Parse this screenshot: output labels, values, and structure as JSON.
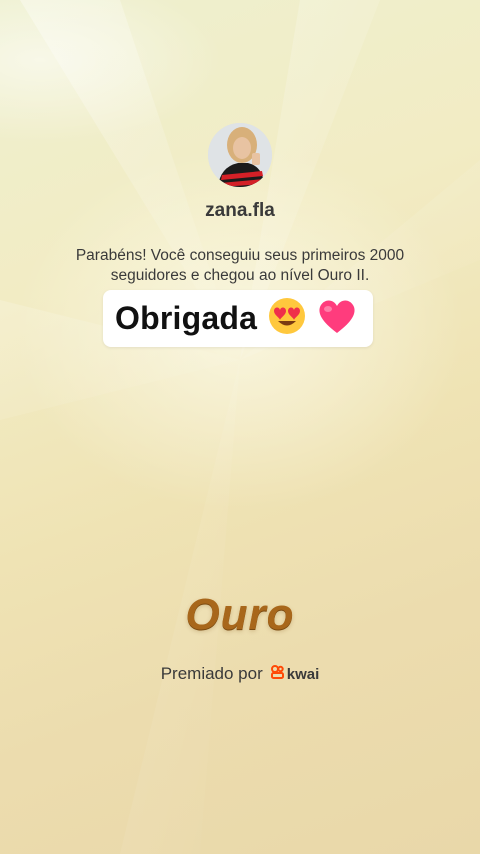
{
  "profile": {
    "username": "zana.fla"
  },
  "message": {
    "text": "Parabéns! Você conseguiu seus primeiros 2000 seguidores e chegou ao nível Ouro II."
  },
  "sticker": {
    "text": "Obrigada",
    "emojis": [
      "smiling-face-with-heart-eyes-icon",
      "pink-heart-icon"
    ]
  },
  "level": {
    "name": "Ouro"
  },
  "award": {
    "prefix": "Premiado por",
    "brand": "kwai",
    "brand_color": "#ff4906"
  },
  "colors": {
    "level_text": "#a8671b",
    "background": "#efe3b4"
  }
}
